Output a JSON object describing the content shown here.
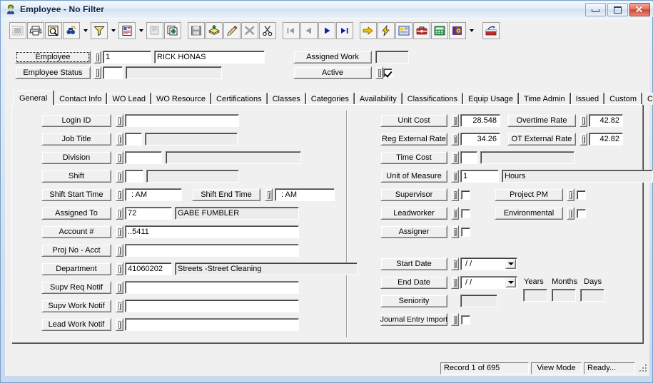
{
  "window": {
    "title": "Employee - No Filter",
    "icon": "employee-icon",
    "minimize_label": "Minimize",
    "restore_label": "Restore",
    "close_label": "Close"
  },
  "toolbar": {
    "groups": [
      [
        {
          "name": "select-all-icon",
          "label": "Select All"
        },
        {
          "name": "print-icon",
          "label": "Print"
        },
        {
          "name": "print-preview-icon",
          "label": "Print Preview"
        },
        {
          "name": "find-icon",
          "label": "Find",
          "dropdown": true
        },
        {
          "name": "filter-icon",
          "label": "Filter",
          "dropdown": true
        },
        {
          "name": "report-icon",
          "label": "Report",
          "dropdown": true
        },
        {
          "name": "properties-icon",
          "label": "Properties"
        },
        {
          "name": "copy-record-icon",
          "label": "Copy Record"
        }
      ],
      [
        {
          "name": "save-icon",
          "label": "Save"
        },
        {
          "name": "add-icon",
          "label": "Add"
        },
        {
          "name": "edit-icon",
          "label": "Edit"
        },
        {
          "name": "delete-icon",
          "label": "Delete"
        },
        {
          "name": "cut-icon",
          "label": "Cut"
        }
      ],
      [
        {
          "name": "first-record-icon",
          "label": "First Record"
        },
        {
          "name": "previous-record-icon",
          "label": "Previous Record"
        },
        {
          "name": "next-record-icon",
          "label": "Next Record"
        },
        {
          "name": "last-record-icon",
          "label": "Last Record"
        }
      ],
      [
        {
          "name": "goto-icon",
          "label": "Go To"
        },
        {
          "name": "quick-action-icon",
          "label": "Quick Action"
        },
        {
          "name": "layout-icon",
          "label": "Layout"
        },
        {
          "name": "toolbox-icon",
          "label": "Toolbox"
        },
        {
          "name": "calculator-icon",
          "label": "Calculator"
        },
        {
          "name": "help-icon",
          "label": "Help",
          "dropdown": true
        }
      ],
      [
        {
          "name": "export-icon",
          "label": "Export"
        }
      ]
    ]
  },
  "header": {
    "employee": {
      "label": "Employee",
      "id": "1",
      "name": "RICK HONAS"
    },
    "employee_status": {
      "label": "Employee Status",
      "code": "",
      "description": ""
    },
    "assigned_work": {
      "label": "Assigned Work",
      "value": ""
    },
    "active": {
      "label": "Active",
      "checked": true
    }
  },
  "tabs": [
    {
      "label": "General",
      "active": true
    },
    {
      "label": "Contact Info",
      "active": false
    },
    {
      "label": "WO Lead",
      "active": false
    },
    {
      "label": "WO Resource",
      "active": false
    },
    {
      "label": "Certifications",
      "active": false
    },
    {
      "label": "Classes",
      "active": false
    },
    {
      "label": "Categories",
      "active": false
    },
    {
      "label": "Availability",
      "active": false
    },
    {
      "label": "Classifications",
      "active": false
    },
    {
      "label": "Equip Usage",
      "active": false
    },
    {
      "label": "Time Admin",
      "active": false
    },
    {
      "label": "Issued",
      "active": false
    },
    {
      "label": "Custom",
      "active": false
    },
    {
      "label": "Comments",
      "active": false
    }
  ],
  "general": {
    "left": {
      "login_id": {
        "label": "Login ID",
        "value": ""
      },
      "job_title": {
        "label": "Job Title",
        "code": "",
        "description": ""
      },
      "division": {
        "label": "Division",
        "code": "",
        "description": ""
      },
      "shift": {
        "label": "Shift",
        "code": "",
        "description": ""
      },
      "shift_start_time": {
        "label": "Shift Start Time",
        "value": ":   AM"
      },
      "shift_end_time": {
        "label": "Shift End Time",
        "value": ":   AM"
      },
      "assigned_to": {
        "label": "Assigned To",
        "code": "72",
        "description": "GABE FUMBLER"
      },
      "account_number": {
        "label": "Account #",
        "value": "..5411"
      },
      "proj_no_acct": {
        "label": "Proj No - Acct",
        "value": ""
      },
      "department": {
        "label": "Department",
        "code": "41060202",
        "description": "Streets -Street Cleaning"
      },
      "supv_req_notif": {
        "label": "Supv Req Notif",
        "value": ""
      },
      "supv_work_notif": {
        "label": "Supv Work Notif",
        "value": ""
      },
      "lead_work_notif": {
        "label": "Lead Work Notif",
        "value": ""
      }
    },
    "right": {
      "unit_cost": {
        "label": "Unit Cost",
        "value": "28.548"
      },
      "overtime_rate": {
        "label": "Overtime Rate",
        "value": "42.82"
      },
      "reg_external_rate": {
        "label": "Reg External Rate",
        "value": "34.26"
      },
      "ot_external_rate": {
        "label": "OT External Rate",
        "value": "42.82"
      },
      "time_cost": {
        "label": "Time Cost",
        "code": "",
        "description": ""
      },
      "unit_of_measure": {
        "label": "Unit of Measure",
        "code": "1",
        "description": "Hours"
      },
      "supervisor": {
        "label": "Supervisor",
        "checked": false
      },
      "project_pm": {
        "label": "Project PM",
        "checked": false
      },
      "leadworker": {
        "label": "Leadworker",
        "checked": false
      },
      "environmental": {
        "label": "Environmental",
        "checked": false
      },
      "assigner": {
        "label": "Assigner",
        "checked": false
      },
      "start_date": {
        "label": "Start Date",
        "value": "/  /"
      },
      "end_date": {
        "label": "End Date",
        "value": "/  /"
      },
      "seniority": {
        "label": "Seniority",
        "value": ""
      },
      "years": {
        "label": "Years",
        "value": ""
      },
      "months": {
        "label": "Months",
        "value": ""
      },
      "days": {
        "label": "Days",
        "value": ""
      },
      "journal_entry_import": {
        "label": "Journal Entry Import",
        "checked": false
      }
    }
  },
  "status": {
    "record": "Record 1 of 695",
    "mode": "View Mode",
    "message": "Ready..."
  }
}
